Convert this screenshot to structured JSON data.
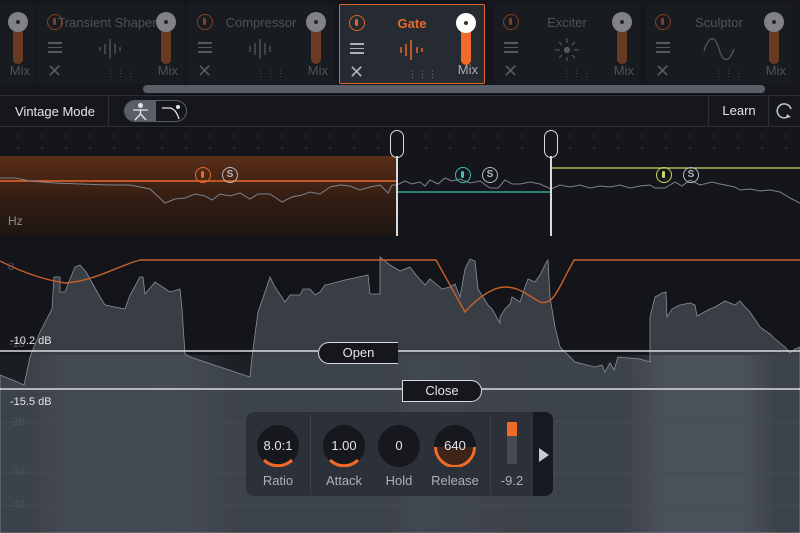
{
  "modules": [
    {
      "name": "",
      "mix_label": "Mix",
      "state": "inactive",
      "glyph": "none"
    },
    {
      "name": "Transient Shaper",
      "mix_label": "Mix",
      "state": "inactive",
      "glyph": "waveform-bars"
    },
    {
      "name": "Compressor",
      "mix_label": "Mix",
      "state": "inactive",
      "glyph": "waveform-bars"
    },
    {
      "name": "Gate",
      "mix_label": "Mix",
      "state": "active",
      "glyph": "waveform-bars"
    },
    {
      "name": "Exciter",
      "mix_label": "Mix",
      "state": "inactive",
      "glyph": "burst"
    },
    {
      "name": "Sculptor",
      "mix_label": "Mix",
      "state": "inactive",
      "glyph": "sine-wave"
    }
  ],
  "module_icons": {
    "power": "power-icon",
    "list": "list-icon",
    "remove": "close-icon",
    "grip": "drag-handle-icon"
  },
  "toolbar": {
    "vintage_mode_label": "Vintage Mode",
    "vintage_toggle_options": [
      "figure-icon",
      "curve-icon"
    ],
    "vintage_toggle_selected": 0,
    "learn_label": "Learn",
    "refresh_icon": "refresh-icon"
  },
  "bands": {
    "axis_label": "Hz",
    "items": [
      {
        "power_color": "#e8692a",
        "solo_label": "S",
        "active": true
      },
      {
        "power_color": "#3fbfae",
        "solo_label": "S",
        "active": false
      },
      {
        "power_color": "#c8d86a",
        "solo_label": "S",
        "active": false
      }
    ]
  },
  "graph": {
    "open_threshold_label": "-10.2 dB",
    "close_threshold_label": "-15.5 dB",
    "open_button_label": "Open",
    "close_button_label": "Close",
    "ticks": [
      "0",
      "-10",
      "-20",
      "-30",
      "-40"
    ],
    "colors": {
      "gain_curve": "#c7602a",
      "waveform": "#59606a"
    }
  },
  "params": {
    "knobs": [
      {
        "label": "Ratio",
        "value": "8.0:1",
        "amount": 0.3
      },
      {
        "label": "Attack",
        "value": "1.00",
        "amount": 0.3
      },
      {
        "label": "Hold",
        "value": "0",
        "amount": 0
      },
      {
        "label": "Release",
        "value": "640",
        "amount": 0.55
      }
    ],
    "meter_value": "-9.2",
    "meter_level": 0.33,
    "expand_icon": "play-icon"
  },
  "accent_color": "#f06a28"
}
